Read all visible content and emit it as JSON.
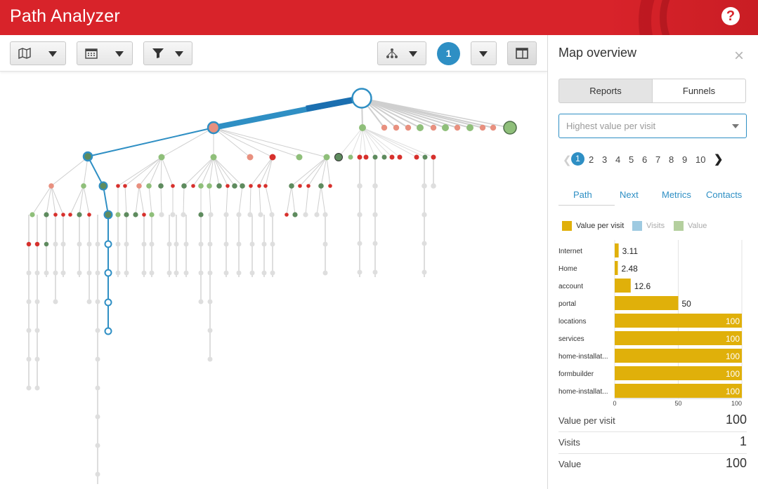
{
  "header": {
    "title": "Path Analyzer",
    "help_label": "?"
  },
  "toolbar": {
    "page_badge": "1"
  },
  "panel": {
    "title": "Map overview",
    "close_label": "×",
    "segments": [
      "Reports",
      "Funnels"
    ],
    "select_placeholder": "Highest value per visit",
    "pagination": {
      "current": "1",
      "pages": [
        "2",
        "3",
        "4",
        "5",
        "6",
        "7",
        "8",
        "9",
        "10"
      ]
    },
    "tabs": [
      "Path",
      "Next",
      "Metrics",
      "Contacts"
    ],
    "legend": [
      {
        "label": "Value per visit",
        "color": "#e0b00a"
      },
      {
        "label": "Visits",
        "color": "#9ecae1"
      },
      {
        "label": "Value",
        "color": "#b4cf9e"
      }
    ],
    "summary": [
      {
        "label": "Value per visit",
        "value": "100"
      },
      {
        "label": "Visits",
        "value": "1"
      },
      {
        "label": "Value",
        "value": "100"
      }
    ]
  },
  "chart_data": {
    "type": "bar",
    "orientation": "horizontal",
    "categories": [
      "Internet",
      "Home",
      "account",
      "portal",
      "locations",
      "services",
      "home-installat...",
      "formbuilder",
      "home-installat..."
    ],
    "series": [
      {
        "name": "Value per visit",
        "values": [
          3.11,
          2.48,
          12.6,
          50,
          100,
          100,
          100,
          100,
          100
        ]
      }
    ],
    "value_labels": [
      "3.11",
      "2.48",
      "12.6",
      "50",
      "100",
      "100",
      "100",
      "100",
      "100"
    ],
    "xlim": [
      0,
      100
    ],
    "xticks": [
      "0",
      "50",
      "100"
    ],
    "color": "#e0b00a"
  }
}
